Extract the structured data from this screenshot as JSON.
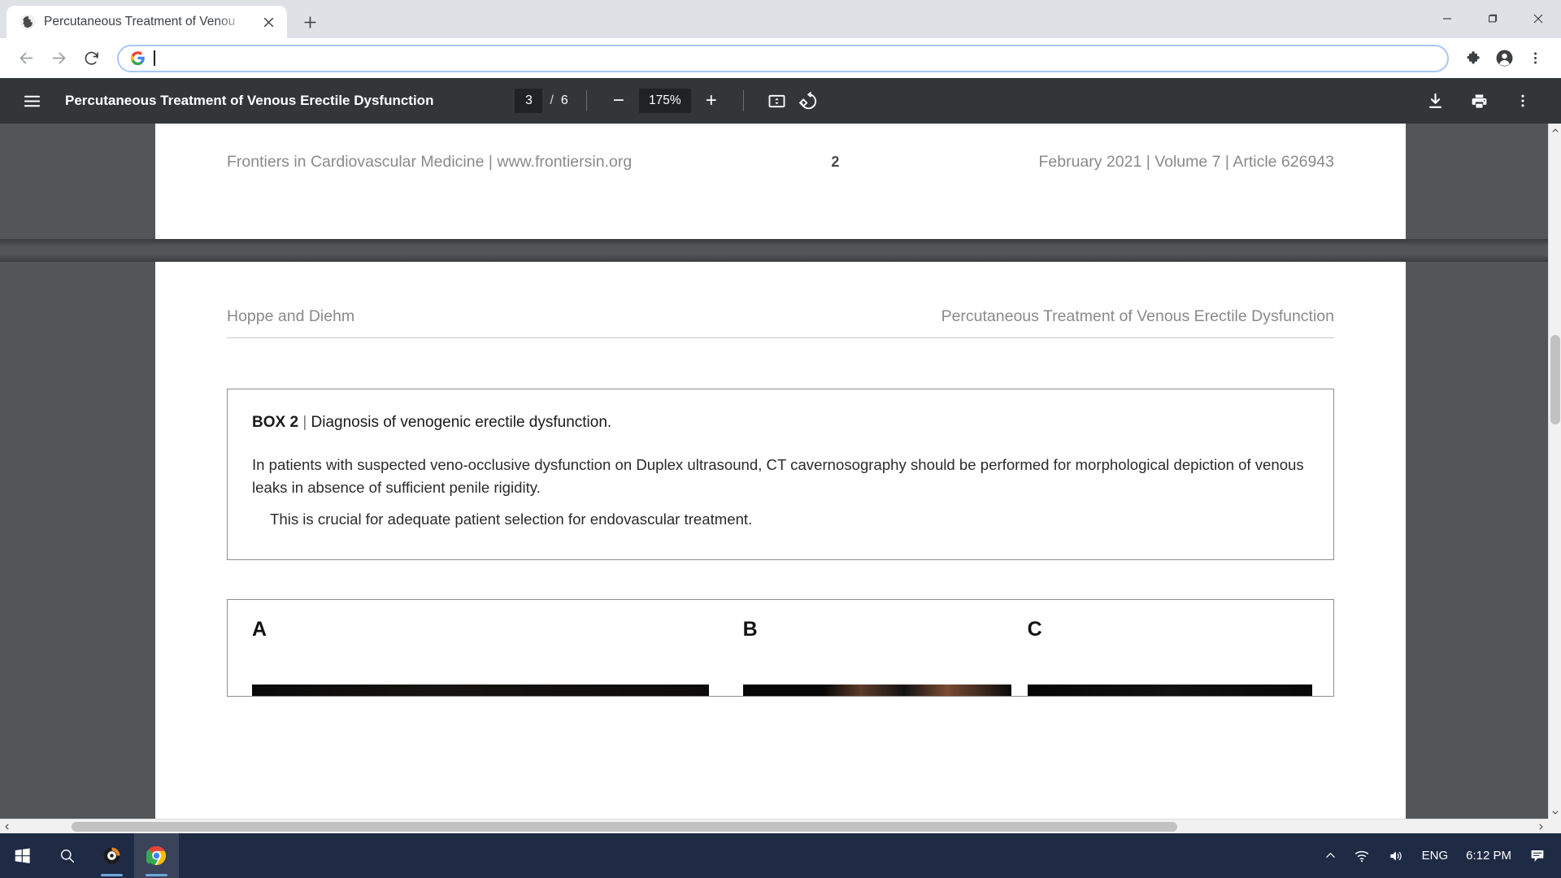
{
  "browser": {
    "tab": {
      "title": "Percutaneous Treatment of Venou",
      "favicon": "globe-icon",
      "close": "close-icon"
    },
    "new_tab_label": "+",
    "window_controls": {
      "minimize": "minimize-icon",
      "maximize": "maximize-icon",
      "close": "close-icon"
    },
    "nav": {
      "back": "back-arrow-icon",
      "forward": "forward-arrow-icon",
      "reload": "reload-icon"
    },
    "omnibox": {
      "value": "",
      "placeholder": "",
      "leading_icon": "google-g-icon"
    },
    "toolbar_right": {
      "extensions": "puzzle-piece-icon",
      "profile": "profile-avatar-icon",
      "menu": "three-dot-menu-icon"
    }
  },
  "pdf": {
    "menu_icon": "hamburger-menu-icon",
    "title": "Percutaneous Treatment of Venous Erectile Dysfunction",
    "page_current": "3",
    "page_separator": "/",
    "page_total": "6",
    "zoom_out_label": "−",
    "zoom_value": "175%",
    "zoom_in_label": "+",
    "fit_icon": "fit-to-page-icon",
    "rotate_icon": "rotate-icon",
    "download_icon": "download-icon",
    "print_icon": "print-icon",
    "more_icon": "three-dot-menu-icon"
  },
  "document": {
    "prev_page_footer": {
      "left": "Frontiers in Cardiovascular Medicine | www.frontiersin.org",
      "center": "2",
      "right": "February 2021 | Volume 7 | Article 626943"
    },
    "running_head": {
      "left": "Hoppe and Diehm",
      "right": "Percutaneous Treatment of Venous Erectile Dysfunction"
    },
    "box": {
      "label": "BOX 2",
      "divider": "|",
      "caption": "Diagnosis of venogenic erectile dysfunction.",
      "paragraph": "In patients with suspected veno-occlusive dysfunction on Duplex ultrasound, CT cavernosography should be performed for morphological depiction of venous leaks in absence of sufficient penile rigidity.",
      "paragraph_indented": "This is crucial for adequate patient selection for endovascular treatment."
    },
    "figure": {
      "panel_a": "A",
      "panel_b": "B",
      "panel_c": "C"
    }
  },
  "scrollbars": {
    "vertical_up": "scroll-up-arrow-icon",
    "vertical_down": "scroll-down-arrow-icon",
    "horizontal_left": "scroll-left-arrow-icon",
    "horizontal_right": "scroll-right-arrow-icon"
  },
  "taskbar": {
    "start": "windows-start-icon",
    "search": "search-icon",
    "app_media": "media-player-icon",
    "app_chrome": "chrome-icon",
    "tray": {
      "chevron": "show-hidden-icons-icon",
      "network": "wifi-icon",
      "volume": "speaker-icon",
      "language": "ENG",
      "time": "6:12 PM",
      "notifications": "notification-icon"
    }
  },
  "colors": {
    "chrome_frame": "#dee1e6",
    "pdf_toolbar": "#323639",
    "pdf_background": "#525659",
    "taskbar": "#1f2a44",
    "omnibox_border": "#a8c7fa"
  }
}
